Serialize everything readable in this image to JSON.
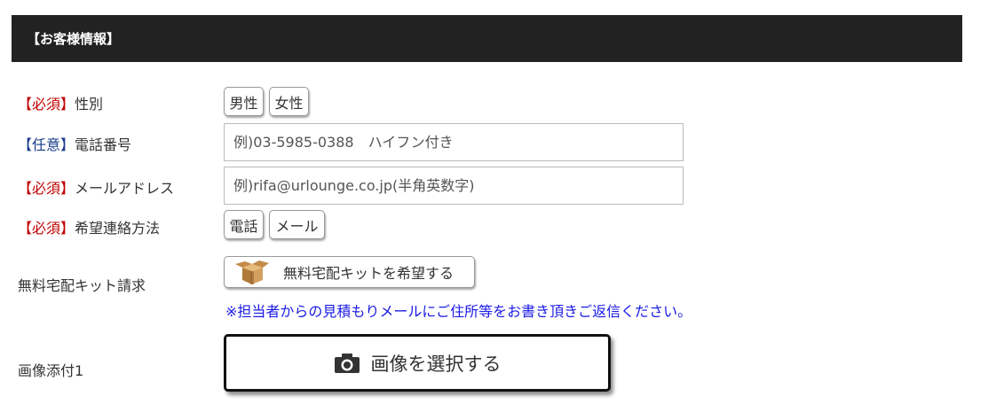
{
  "section": {
    "title": "【お客様情報】"
  },
  "gender": {
    "badge": "【必須】",
    "label": "性別",
    "options": [
      "男性",
      "女性"
    ]
  },
  "phone": {
    "badge": "【任意】",
    "label": "電話番号",
    "placeholder": "例)03-5985-0388　ハイフン付き"
  },
  "email": {
    "badge": "【必須】",
    "label": "メールアドレス",
    "placeholder": "例)rifa@urlounge.co.jp(半角英数字)"
  },
  "contact_method": {
    "badge": "【必須】",
    "label": "希望連絡方法",
    "options": [
      "電話",
      "メール"
    ]
  },
  "kit": {
    "label": "無料宅配キット請求",
    "button_label": "無料宅配キットを希望する",
    "icon": "cardboard-box-icon",
    "note": "※担当者からの見積もりメールにご住所等をお書き頂きご返信ください。"
  },
  "image": {
    "label": "画像添付1",
    "button_label": "画像を選択する",
    "icon": "camera-icon"
  },
  "colors": {
    "header_bg": "#222222",
    "required": "#c00000",
    "optional": "#1a3c8c",
    "note": "#1a1ae6"
  }
}
